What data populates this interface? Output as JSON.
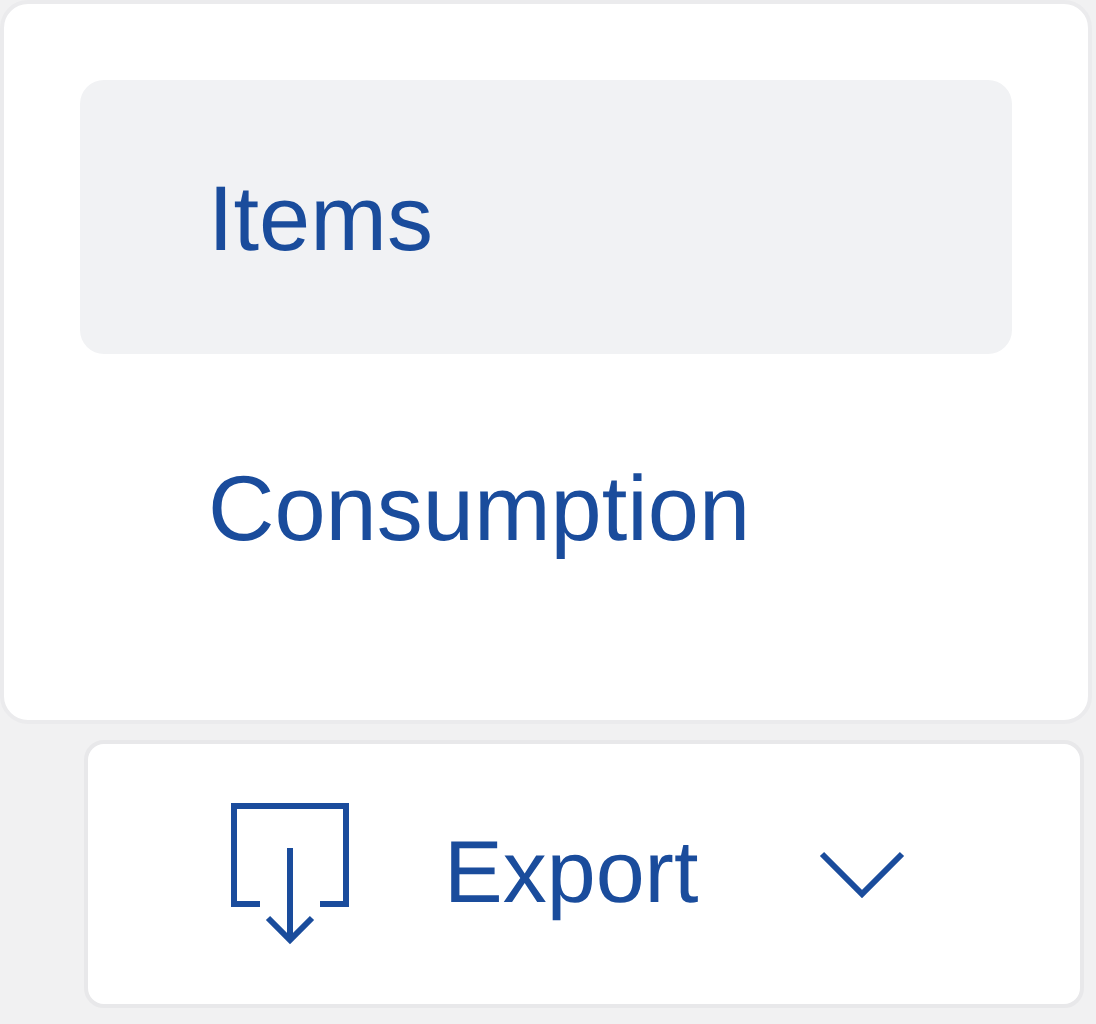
{
  "menu": {
    "items": [
      {
        "label": "Items",
        "selected": true
      },
      {
        "label": "Consumption",
        "selected": false
      }
    ]
  },
  "export_button": {
    "label": "Export"
  }
}
